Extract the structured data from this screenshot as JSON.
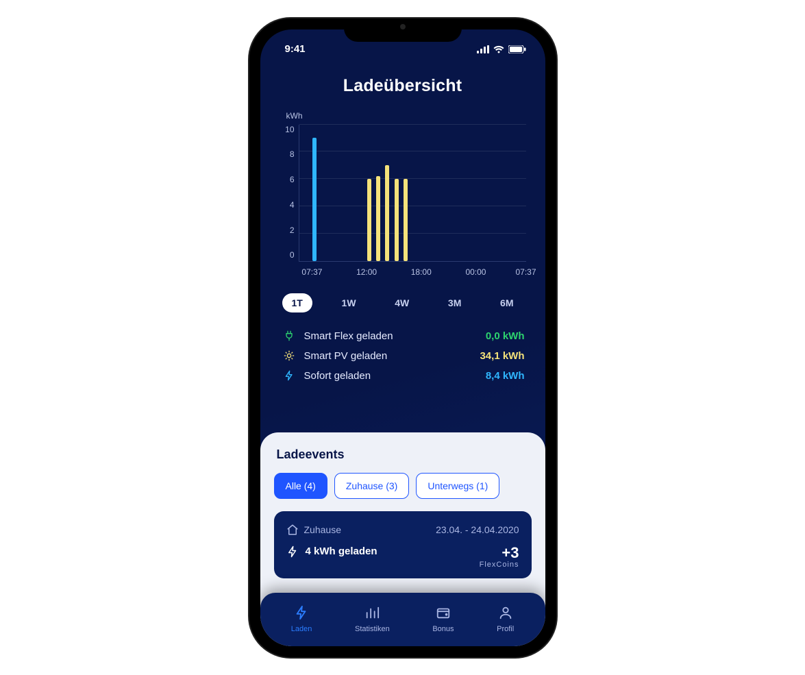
{
  "status": {
    "time": "9:41"
  },
  "header": {
    "title": "Ladeübersicht"
  },
  "chart_data": {
    "type": "bar",
    "ylabel": "kWh",
    "ylim": [
      0,
      10
    ],
    "yticks": [
      10,
      8,
      6,
      4,
      2,
      0
    ],
    "xticks": [
      "07:37",
      "12:00",
      "18:00",
      "00:00",
      "07:37"
    ],
    "xtick_pos_pct": [
      6,
      30,
      54,
      78,
      100
    ],
    "series": [
      {
        "name": "Sofort geladen",
        "color": "#2fb6ff",
        "bars": [
          {
            "x_pct": 6,
            "value": 9.0
          }
        ]
      },
      {
        "name": "Smart PV geladen",
        "color": "#f5e27a",
        "bars": [
          {
            "x_pct": 30,
            "value": 6.0
          },
          {
            "x_pct": 34,
            "value": 6.2
          },
          {
            "x_pct": 38,
            "value": 7.0
          },
          {
            "x_pct": 42,
            "value": 6.0
          },
          {
            "x_pct": 46,
            "value": 6.0
          }
        ]
      }
    ]
  },
  "ranges": {
    "items": [
      "1T",
      "1W",
      "4W",
      "3M",
      "6M"
    ],
    "active": 0
  },
  "stats": [
    {
      "icon": "plug-icon",
      "color": "#2dd36f",
      "label": "Smart Flex geladen",
      "value": "0,0 kWh"
    },
    {
      "icon": "sun-icon",
      "color": "#f5e27a",
      "label": "Smart PV geladen",
      "value": "34,1 kWh"
    },
    {
      "icon": "bolt-icon",
      "color": "#2fb6ff",
      "label": "Sofort geladen",
      "value": "8,4 kWh"
    }
  ],
  "events": {
    "title": "Ladeevents",
    "filters": [
      {
        "label": "Alle (4)",
        "active": true
      },
      {
        "label": "Zuhause (3)",
        "active": false
      },
      {
        "label": "Unterwegs (1)",
        "active": false
      }
    ],
    "card": {
      "location": "Zuhause",
      "date": "23.04. - 24.04.2020",
      "loaded": "4 kWh geladen",
      "flexcoins_value": "+3",
      "flexcoins_label": "FlexCoins"
    }
  },
  "tabs": [
    {
      "icon": "bolt-icon",
      "label": "Laden",
      "active": true
    },
    {
      "icon": "chart-icon",
      "label": "Statistiken",
      "active": false
    },
    {
      "icon": "wallet-icon",
      "label": "Bonus",
      "active": false
    },
    {
      "icon": "profile-icon",
      "label": "Profil",
      "active": false
    }
  ]
}
